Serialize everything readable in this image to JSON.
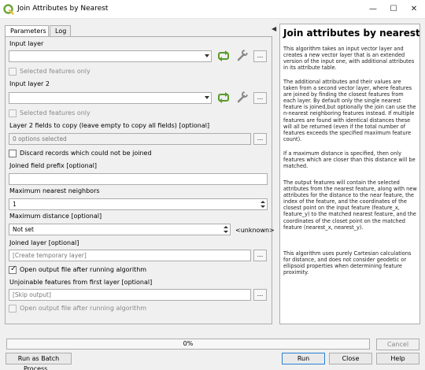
{
  "window": {
    "title": "Join Attributes by Nearest",
    "controls": {
      "minimize": "—",
      "maximize": "☐",
      "close": "✕"
    }
  },
  "tabs": [
    "Parameters",
    "Log"
  ],
  "params": {
    "input_layer": {
      "label": "Input layer",
      "value": "",
      "selected_only": "Selected features only"
    },
    "input_layer_2": {
      "label": "Input layer 2",
      "value": "",
      "selected_only": "Selected features only"
    },
    "fields_to_copy": {
      "label": "Layer 2 fields to copy (leave empty to copy all fields) [optional]",
      "value": "0 options selected"
    },
    "discard": {
      "label": "Discard records which could not be joined"
    },
    "prefix": {
      "label": "Joined field prefix [optional]",
      "value": ""
    },
    "max_neighbors": {
      "label": "Maximum nearest neighbors",
      "value": "1"
    },
    "max_distance": {
      "label": "Maximum distance [optional]",
      "value": "Not set",
      "unit": "<unknown>"
    },
    "joined_layer": {
      "label": "Joined layer [optional]",
      "placeholder": "[Create temporary layer]",
      "open_output": "Open output file after running algorithm"
    },
    "unjoinable": {
      "label": "Unjoinable features from first layer [optional]",
      "placeholder": "[Skip output]",
      "open_output": "Open output file after running algorithm"
    }
  },
  "ellipsis": "...",
  "help": {
    "heading": "Join attributes by nearest",
    "paragraphs": [
      "This algorithm takes an input vector layer and creates a new vector layer that is an extended version of the input one, with additional attributes in its attribute table.",
      "The additional attributes and their values are taken from a second vector layer, where features are joined by finding the closest features from each layer. By default only the single nearest feature is joined,but optionally the join can use the n-nearest neighboring features instead. If multiple features are found with identical distances these will all be returned (even if the total number of features exceeds the specified maximum feature count).",
      "If a maximum distance is specified, then only features which are closer than this distance will be matched.",
      "The output features will contain the selected attributes from the nearest feature, along with new attributes for the distance to the near feature, the index of the feature, and the coordinates of the closest point on the input feature (feature_x, feature_y) to the matched nearest feature, and the coordinates of the closet point on the matched feature (nearest_x, nearest_y).",
      "This algorithm uses purely Cartesian calculations for distance, and does not consider geodetic or ellipsoid properties when determining feature proximity."
    ]
  },
  "progress": {
    "value": 0.0,
    "text": "0%"
  },
  "buttons": {
    "cancel": "Cancel",
    "batch": "Run as Batch Process...",
    "run": "Run",
    "close": "Close",
    "help": "Help"
  },
  "colors": {
    "accent": "#2a7fd4",
    "qgis_green": "#6fa43c"
  }
}
